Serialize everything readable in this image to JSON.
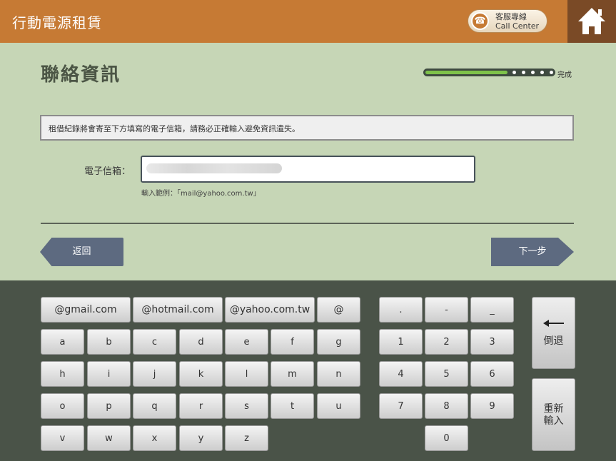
{
  "header": {
    "title": "行動電源租賃",
    "call_center_zh": "客服專線",
    "call_center_en": "Call Center"
  },
  "page": {
    "title": "聯絡資訊"
  },
  "progress": {
    "value": 0.64,
    "steps_remaining": 5,
    "label": "完成"
  },
  "notice": "租借紀錄將會寄至下方填寫的電子信箱，請務必正確輸入避免資訊遺失。",
  "form": {
    "email_label": "電子信箱：",
    "email_value": "",
    "example": "輸入範例：「mail@yahoo.com.tw」"
  },
  "nav": {
    "back": "返回",
    "next": "下一步"
  },
  "keyboard": {
    "domains": [
      "@gmail.com",
      "@hotmail.com",
      "@yahoo.com.tw",
      "@"
    ],
    "row_a": [
      "a",
      "b",
      "c",
      "d",
      "e",
      "f",
      "g"
    ],
    "row_h": [
      "h",
      "i",
      "j",
      "k",
      "l",
      "m",
      "n"
    ],
    "row_o": [
      "o",
      "p",
      "q",
      "r",
      "s",
      "t",
      "u"
    ],
    "row_v": [
      "v",
      "w",
      "x",
      "y",
      "z"
    ],
    "symbols": [
      ".",
      "-",
      "_"
    ],
    "digits": [
      "1",
      "2",
      "3",
      "4",
      "5",
      "6",
      "7",
      "8",
      "9",
      "0"
    ],
    "backspace": "倒退",
    "reset_line1": "重新",
    "reset_line2": "輸入"
  }
}
